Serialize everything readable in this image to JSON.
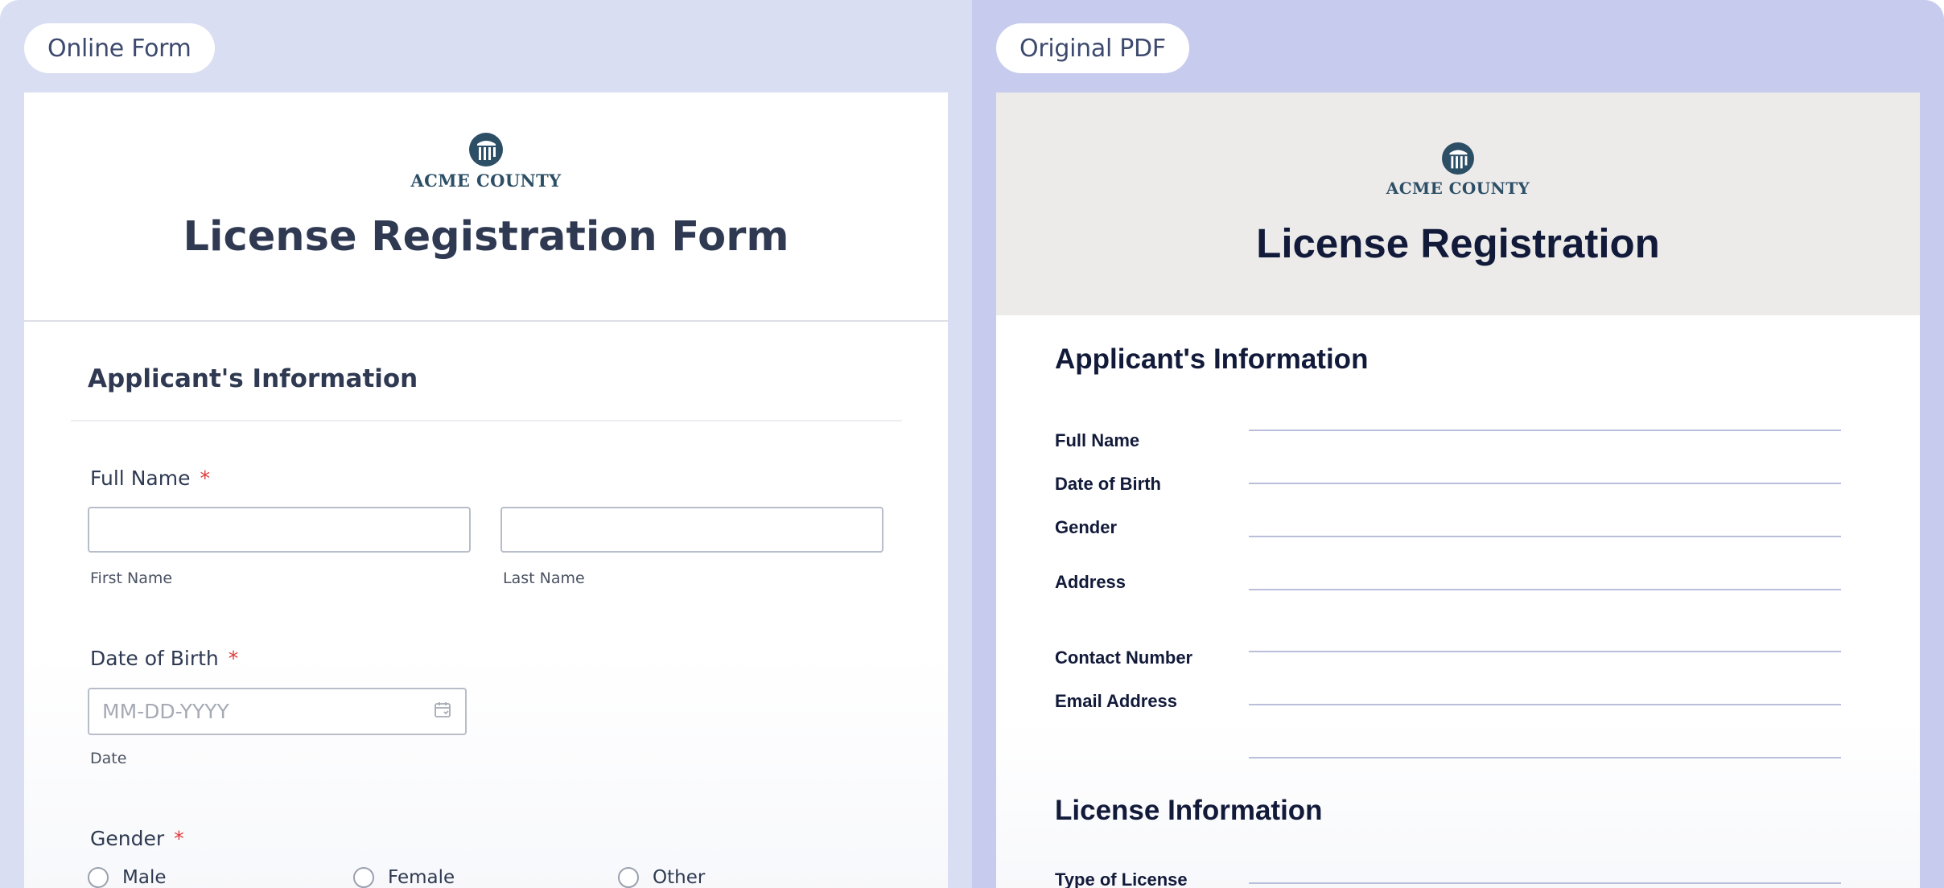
{
  "online_form": {
    "tab_label": "Online Form",
    "logo_text": "ACME COUNTY",
    "title": "License Registration Form",
    "section_title": "Applicant's Information",
    "full_name": {
      "label": "Full Name",
      "required_mark": "*",
      "first_name_sublabel": "First Name",
      "last_name_sublabel": "Last Name",
      "first_name_value": "",
      "last_name_value": ""
    },
    "date_of_birth": {
      "label": "Date of Birth",
      "required_mark": "*",
      "placeholder": "MM-DD-YYYY",
      "sublabel": "Date",
      "icon": "calendar-icon"
    },
    "gender": {
      "label": "Gender",
      "required_mark": "*",
      "options": [
        "Male",
        "Female",
        "Other"
      ]
    }
  },
  "original_pdf": {
    "tab_label": "Original PDF",
    "logo_text": "ACME COUNTY",
    "title": "License Registration",
    "section_applicant": "Applicant's Information",
    "fields": [
      "Full Name",
      "Date of Birth",
      "Gender",
      "Address",
      "Contact Number",
      "Email Address"
    ],
    "section_license": "License Information",
    "license_fields": [
      "Type of License"
    ]
  },
  "colors": {
    "left_background": "#dadef2",
    "right_background": "#c7ccee",
    "brand_navy": "#2d4f66",
    "required_red": "#e03b3b",
    "heading_text": "#2f3a52"
  }
}
